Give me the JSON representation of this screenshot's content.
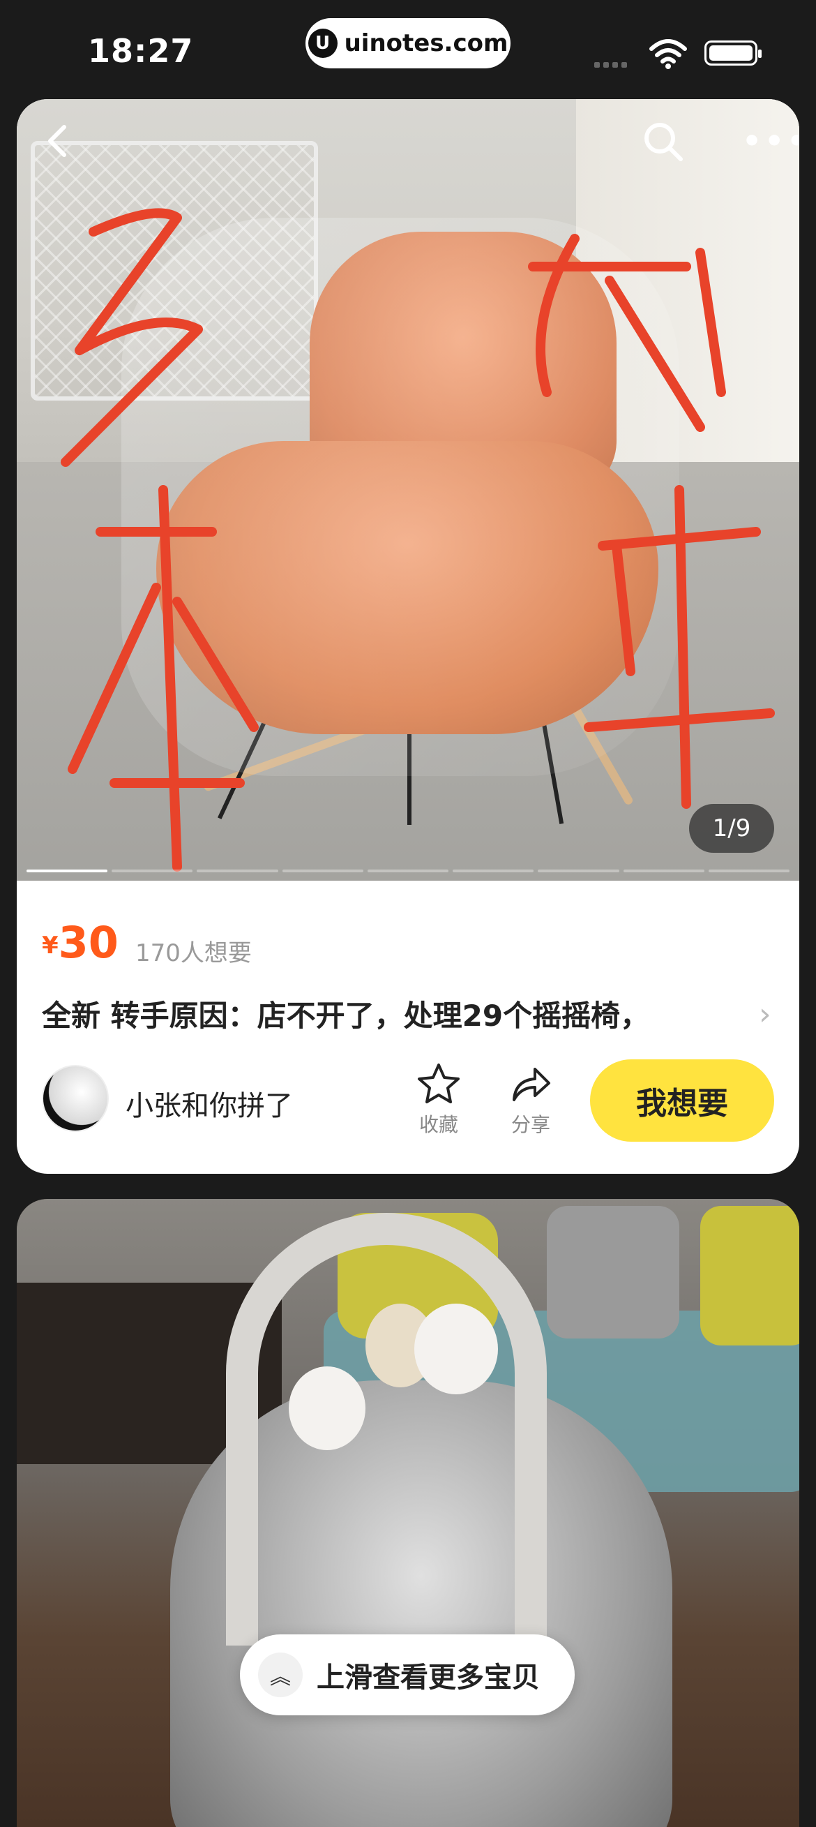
{
  "status_bar": {
    "time": "18:27",
    "url": "uinotes.com",
    "url_icon": "u-logo-icon"
  },
  "listing": {
    "image_counter": "1/9",
    "image_count": 9,
    "current_image": 1,
    "price_currency": "¥",
    "price_value": "30",
    "wants": "170人想要",
    "title": "全新 转手原因：店不开了，处理29个摇摇椅，",
    "seller_name": "小张和你拼了",
    "favorite_label": "收藏",
    "share_label": "分享",
    "want_button": "我想要",
    "accent_color": "#ff5a1a",
    "button_color": "#ffe33f",
    "scribble_color": "#e8432a"
  },
  "swipe_hint": {
    "label": "上滑查看更多宝贝",
    "icon": "double-chevron-up-icon"
  }
}
